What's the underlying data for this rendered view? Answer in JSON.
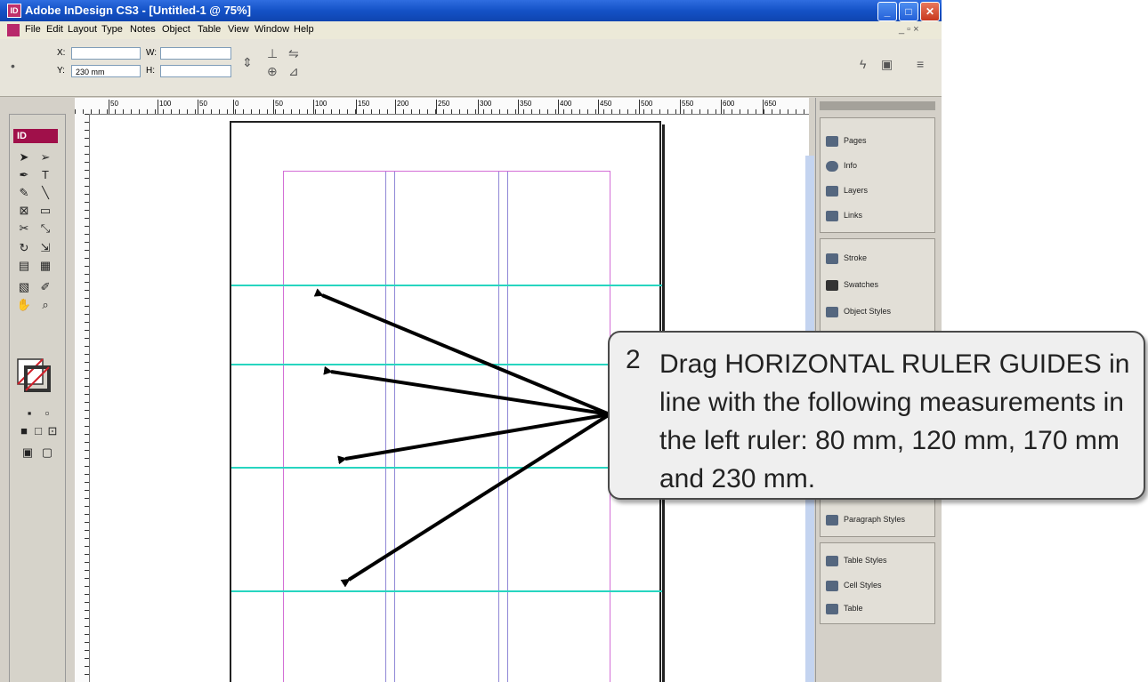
{
  "window": {
    "title": "Adobe InDesign CS3 - [Untitled-1 @ 75%]",
    "app_icon_label": "ID",
    "minimize": "_",
    "maximize": "□",
    "close": "✕"
  },
  "menu": {
    "items": [
      "File",
      "Edit",
      "Layout",
      "Type",
      "Notes",
      "Object",
      "Table",
      "View",
      "Window",
      "Help"
    ],
    "doc_controls": "_ ▫ ×"
  },
  "control_bar": {
    "x_label": "X:",
    "x_value": "",
    "y_label": "Y:",
    "y_value": "230 mm",
    "w_label": "W:",
    "h_label": "H:"
  },
  "ruler": {
    "top_ticks": [
      "50",
      "100",
      "50",
      "0",
      "50",
      "100",
      "150",
      "200",
      "250",
      "300",
      "350",
      "400",
      "450",
      "500",
      "550",
      "600",
      "650"
    ]
  },
  "tools": {
    "logo": "ID"
  },
  "panels": {
    "group1": [
      "Pages",
      "Info",
      "Layers",
      "Links"
    ],
    "group2": [
      "Stroke",
      "Swatches",
      "Object Styles"
    ],
    "group3": [
      "Paragraph Styles"
    ],
    "group4": [
      "Table Styles",
      "Cell Styles",
      "Table"
    ]
  },
  "callout": {
    "number": "2",
    "text": "Drag HORIZONTAL RULER GUIDES in line with the following measurements in the left ruler: 80 mm, 120 mm, 170 mm and 230 mm."
  },
  "colors": {
    "guide": "#27d5c0",
    "margin": "#d36ed6",
    "column": "#8f87d6",
    "title_bar": "#1452c6"
  }
}
